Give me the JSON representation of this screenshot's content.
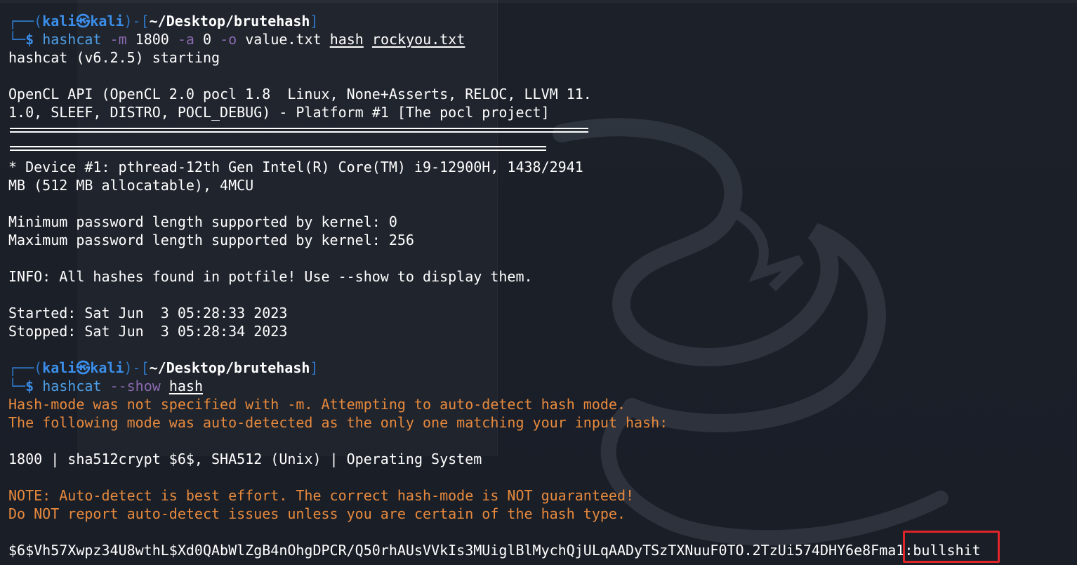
{
  "prompt1": {
    "corner_top": "┌──(",
    "user": "kali",
    "at": "㉿",
    "host": "kali",
    "mid": ")-[",
    "path": "~/Desktop/brutehash",
    "end": "]",
    "corner_bottom": "└─",
    "dollar": "$",
    "cmd": "hashcat",
    "opt1": "-m",
    "val1": "1800",
    "opt2": "-a",
    "val2": "0",
    "opt3": "-o",
    "val3": "value.txt",
    "arg1": "hash",
    "arg2": "rockyou.txt"
  },
  "output1": {
    "starting": "hashcat (v6.2.5) starting",
    "opencl1": "OpenCL API (OpenCL 2.0 pocl 1.8  Linux, None+Asserts, RELOC, LLVM 11.",
    "opencl2": "1.0, SLEEF, DISTRO, POCL_DEBUG) - Platform #1 [The pocl project]",
    "device1": "* Device #1: pthread-12th Gen Intel(R) Core(TM) i9-12900H, 1438/2941",
    "device2": "MB (512 MB allocatable), 4MCU",
    "minpw": "Minimum password length supported by kernel: 0",
    "maxpw": "Maximum password length supported by kernel: 256",
    "info": "INFO: All hashes found in potfile! Use --show to display them.",
    "started": "Started: Sat Jun  3 05:28:33 2023",
    "stopped": "Stopped: Sat Jun  3 05:28:34 2023"
  },
  "prompt2": {
    "cmd": "hashcat",
    "opt1": "--show",
    "arg1": "hash"
  },
  "output2": {
    "warn1": "Hash-mode was not specified with -m. Attempting to auto-detect hash mode.",
    "warn2": "The following mode was auto-detected as the only one matching your input hash:",
    "mode": "1800 | sha512crypt $6$, SHA512 (Unix) | Operating System",
    "note1": "NOTE: Auto-detect is best effort. The correct hash-mode is NOT guaranteed!",
    "note2": "Do NOT report auto-detect issues unless you are certain of the hash type.",
    "hash": "$6$Vh57Xwpz34U8wthL$Xd0QAbWlZgB4nOhgDPCR/Q50rhAUsVVkIs3MUiglBlMychQjULqAADyTSzTXNuuF0TO.2TzUi574DHY6e8Fma1:",
    "password": "bullshit"
  },
  "colors": {
    "background": "#1c2029",
    "prompt_blue": "#3b8eea",
    "option_purple": "#8a6ab0",
    "warning_orange": "#e88a3d",
    "highlight_red": "#e0252a"
  }
}
